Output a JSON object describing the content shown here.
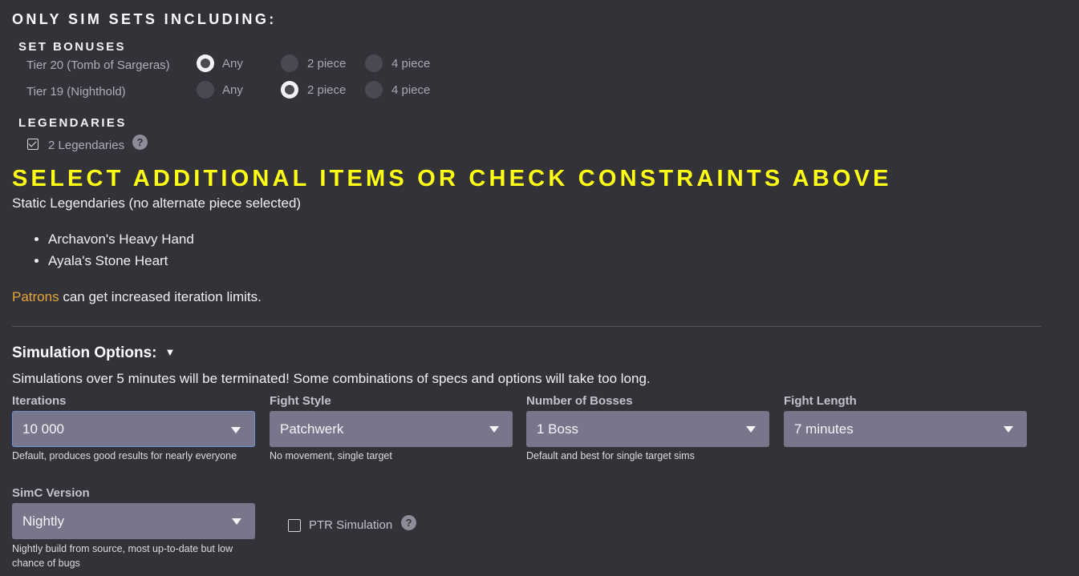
{
  "header": {
    "title": "ONLY SIM SETS INCLUDING:",
    "set_bonuses_title": "SET BONUSES",
    "legendaries_title": "LEGENDARIES"
  },
  "set_bonuses": [
    {
      "label": "Tier 20 (Tomb of Sargeras)",
      "options": [
        "Any",
        "2 piece",
        "4 piece"
      ],
      "selected": "Any"
    },
    {
      "label": "Tier 19 (Nighthold)",
      "options": [
        "Any",
        "2 piece",
        "4 piece"
      ],
      "selected": "2 piece"
    }
  ],
  "legendaries": {
    "checkbox_label": "2 Legendaries",
    "checked": true,
    "help_glyph": "?"
  },
  "notice": {
    "headline": "SELECT ADDITIONAL ITEMS OR CHECK CONSTRAINTS ABOVE",
    "static_text": "Static Legendaries (no alternate piece selected)",
    "items": [
      "Archavon's Heavy Hand",
      "Ayala's Stone Heart"
    ],
    "patrons_link": "Patrons",
    "patrons_text": " can get increased iteration limits."
  },
  "simulation": {
    "title": "Simulation Options:",
    "caret": "▼",
    "warning": "Simulations over 5 minutes will be terminated! Some combinations of specs and options will take too long.",
    "fields": [
      {
        "label": "Iterations",
        "value": "10 000",
        "hint": "Default, produces good results for nearly everyone"
      },
      {
        "label": "Fight Style",
        "value": "Patchwerk",
        "hint": "No movement, single target"
      },
      {
        "label": "Number of Bosses",
        "value": "1 Boss",
        "hint": "Default and best for single target sims"
      },
      {
        "label": "Fight Length",
        "value": "7 minutes",
        "hint": ""
      }
    ],
    "simc_version": {
      "label": "SimC Version",
      "value": "Nightly",
      "hint": "Nightly build from source, most up-to-date but low chance of bugs"
    },
    "ptr": {
      "label": "PTR Simulation",
      "checked": false,
      "help_glyph": "?"
    }
  },
  "colors": {
    "background": "#333239",
    "headline_yellow": "#ffff14",
    "patrons_link": "#e5a639",
    "select_bg": "#77768a"
  }
}
